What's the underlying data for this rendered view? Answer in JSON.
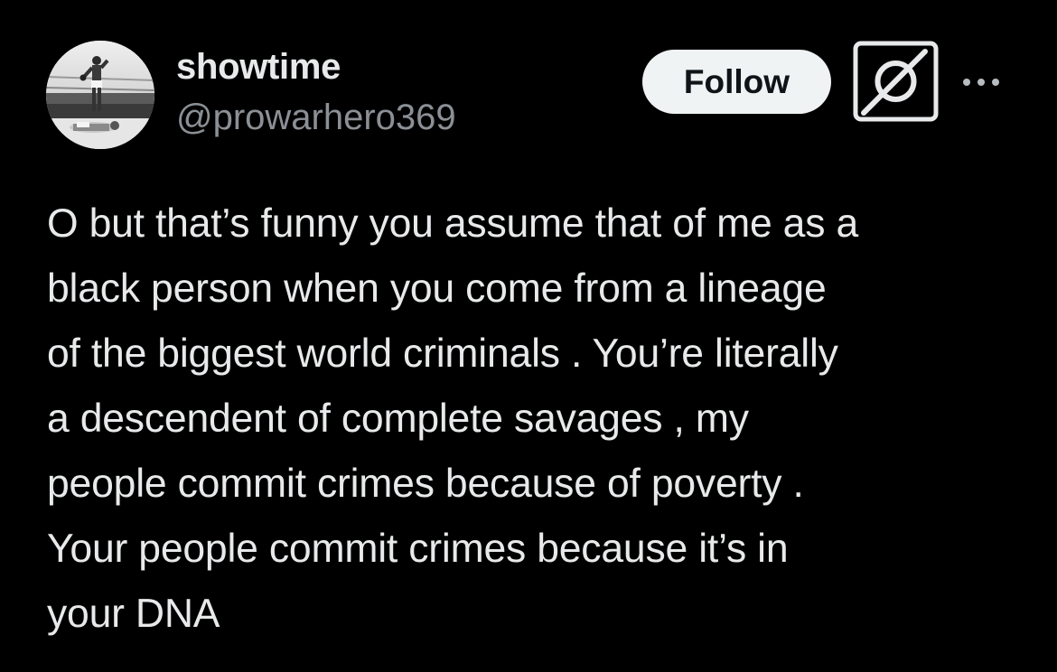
{
  "author": {
    "display_name": "showtime",
    "handle": "@prowarhero369",
    "avatar_icon": "boxing-photo-avatar"
  },
  "actions": {
    "follow_label": "Follow",
    "grok_icon": "grok-icon",
    "more_icon": "more-dots-icon"
  },
  "post": {
    "text": "O but that’s funny you assume that of me as a\nblack person when you come from a lineage\nof the biggest world criminals . You’re literally\na descendent of complete savages , my\npeople commit crimes because of poverty .\nYour people commit crimes because it’s in\nyour DNA"
  },
  "colors": {
    "background": "#000000",
    "text_primary": "#e7e9ea",
    "text_secondary": "#8b9096",
    "follow_bg": "#eff3f4",
    "follow_text": "#0f1419"
  }
}
